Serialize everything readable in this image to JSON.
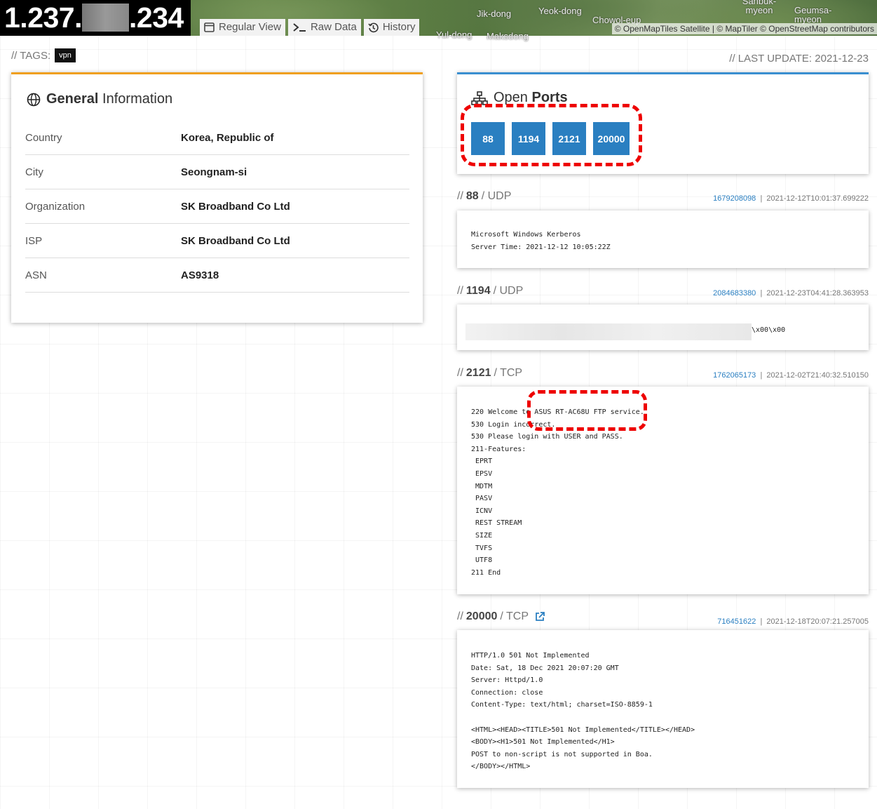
{
  "header": {
    "ip_prefix": "1.237.",
    "ip_suffix": ".234",
    "tabs": [
      {
        "label": "Regular View",
        "icon": "window-icon"
      },
      {
        "label": "Raw Data",
        "icon": "terminal-icon"
      },
      {
        "label": "History",
        "icon": "history-icon"
      }
    ],
    "map_labels": [
      "Jik-dong",
      "Yeok-dong",
      "Chowol-eup",
      "Sanbuk-myeon",
      "Geumsa-myeon",
      "Yul-dong",
      "Maksdong"
    ],
    "attribution": "© OpenMapTiles Satellite | © MapTiler © OpenStreetMap contributors"
  },
  "tags": {
    "label": "// TAGS:",
    "items": [
      "vpn"
    ]
  },
  "last_update": "// LAST UPDATE: 2021-12-23",
  "general": {
    "title_bold": "General",
    "title_rest": "Information",
    "rows": [
      {
        "key": "Country",
        "value": "Korea, Republic of"
      },
      {
        "key": "City",
        "value": "Seongnam-si"
      },
      {
        "key": "Organization",
        "value": "SK Broadband Co Ltd"
      },
      {
        "key": "ISP",
        "value": "SK Broadband Co Ltd"
      },
      {
        "key": "ASN",
        "value": "AS9318"
      }
    ]
  },
  "ports": {
    "title_light": "Open",
    "title_bold": "Ports",
    "items": [
      "88",
      "1194",
      "2121",
      "20000"
    ]
  },
  "services": [
    {
      "slash": "//",
      "port": "88",
      "proto": "/ UDP",
      "hash": "1679208098",
      "timestamp": "2021-12-12T10:01:37.699222",
      "lines": [
        "Microsoft Windows Kerberos",
        "Server Time: 2021-12-12 10:05:22Z"
      ]
    },
    {
      "slash": "//",
      "port": "1194",
      "proto": "/ UDP",
      "hash": "2084683380",
      "timestamp": "2021-12-23T04:41:28.363953",
      "lines": [
        "\\x00\\x00"
      ]
    },
    {
      "slash": "//",
      "port": "2121",
      "proto": "/ TCP",
      "hash": "1762065173",
      "timestamp": "2021-12-02T21:40:32.510150",
      "lines": [
        "220 Welcome to ASUS RT-AC68U FTP service.",
        "530 Login incorrect.",
        "530 Please login with USER and PASS.",
        "211-Features:",
        " EPRT",
        " EPSV",
        " MDTM",
        " PASV",
        " ICNV",
        " REST STREAM",
        " SIZE",
        " TVFS",
        " UTF8",
        "211 End"
      ]
    },
    {
      "slash": "//",
      "port": "20000",
      "proto": "/ TCP",
      "hash": "716451622",
      "timestamp": "2021-12-18T20:07:21.257005",
      "lines": [
        "HTTP/1.0 501 Not Implemented",
        "Date: Sat, 18 Dec 2021 20:07:20 GMT",
        "Server: Httpd/1.0",
        "Connection: close",
        "Content-Type: text/html; charset=ISO-8859-1",
        "",
        "<HTML><HEAD><TITLE>501 Not Implemented</TITLE></HEAD>",
        "<BODY><H1>501 Not Implemented</H1>",
        "POST to non-script is not supported in Boa.",
        "</BODY></HTML>"
      ]
    }
  ],
  "meta_separator": "|",
  "colors": {
    "accent_orange": "#f0a020",
    "accent_blue": "#3a8fd0",
    "port_blue": "#2a7fc1",
    "annotation_red": "#e00000"
  }
}
